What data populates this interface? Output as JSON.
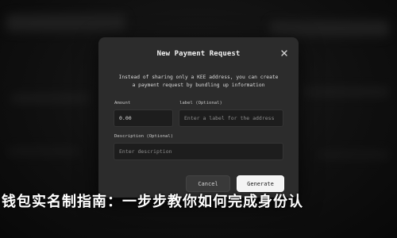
{
  "modal": {
    "title": "New Payment Request",
    "description_line1": "Instead of sharing only a KEE address, you can create",
    "description_line2": "a payment request by bundling up information",
    "amount_label": "Amount",
    "amount_value": "0.00",
    "label_label": "label (Optional)",
    "label_placeholder": "Enter a label for the address",
    "description_label": "Description (Optional)",
    "description_placeholder": "Enter description",
    "cancel_label": "Cancel",
    "generate_label": "Generate"
  },
  "banner": {
    "text": "钱包实名制指南：一步步教你如何完成身份认"
  },
  "colors": {
    "modal_bg": "#2c2c2c",
    "input_bg": "#1d1d1d",
    "primary_button": "#f4f4f4",
    "secondary_button": "#393939",
    "page_bg": "#0e0e0e"
  },
  "icons": {
    "close": "close-icon"
  }
}
